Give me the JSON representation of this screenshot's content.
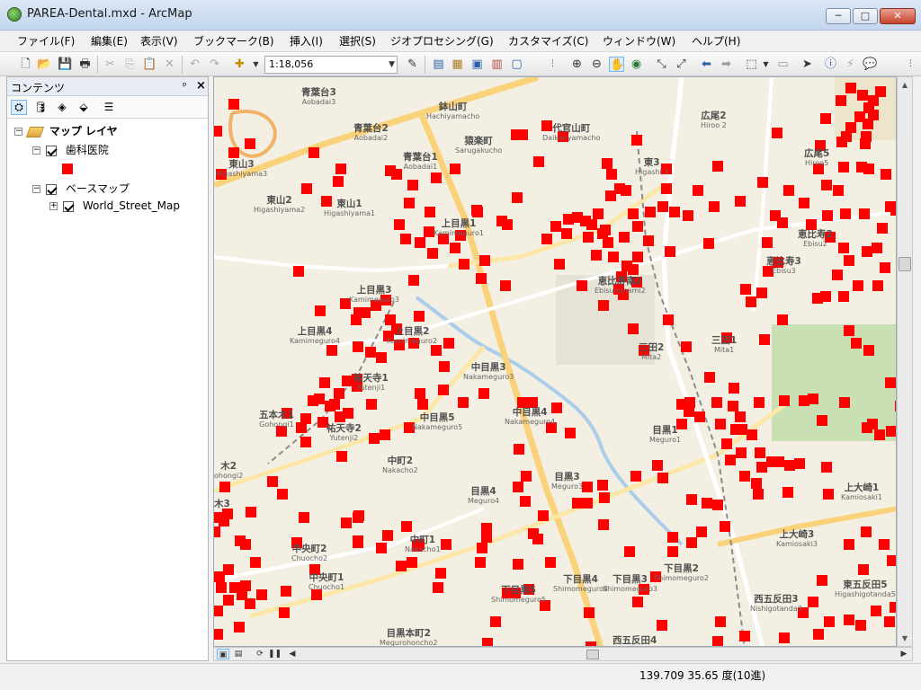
{
  "window": {
    "title": "PAREA-Dental.mxd - ArcMap",
    "minimize_glyph": "─",
    "maximize_glyph": "□",
    "close_glyph": "✕"
  },
  "menu": [
    {
      "label": "ファイル(F)"
    },
    {
      "label": "編集(E)"
    },
    {
      "label": "表示(V)"
    },
    {
      "label": "ブックマーク(B)"
    },
    {
      "label": "挿入(I)"
    },
    {
      "label": "選択(S)"
    },
    {
      "label": "ジオプロセシング(G)"
    },
    {
      "label": "カスタマイズ(C)"
    },
    {
      "label": "ウィンドウ(W)"
    },
    {
      "label": "ヘルプ(H)"
    }
  ],
  "toolbar": {
    "scale_value": "1:18,056"
  },
  "contents": {
    "header": "コンテンツ",
    "pin_glyph": "ᵖ",
    "close_glyph": "×",
    "root_label": "マップ レイヤ",
    "layer1_label": "歯科医院",
    "layer1_color": "#ff0000",
    "group_label": "ベースマップ",
    "layer2_label": "World_Street_Map"
  },
  "map": {
    "point_color": "#ff0000",
    "places": [
      {
        "jp": "青葉台3",
        "en": "Aobadai3"
      },
      {
        "jp": "鉢山町",
        "en": "Hachiyamacho"
      },
      {
        "jp": "鶯谷町",
        "en": "Uguisudanicho"
      },
      {
        "jp": "代官山町",
        "en": "Daikanyamacho"
      },
      {
        "jp": "広尾2",
        "en": "Hiroo 2"
      },
      {
        "jp": "青葉台2",
        "en": "Aobadai2"
      },
      {
        "jp": "猿楽町",
        "en": "Sarugakucho"
      },
      {
        "jp": "青葉台1",
        "en": "Aobadai1"
      },
      {
        "jp": "東3",
        "en": "Higashi 3"
      },
      {
        "jp": "広尾5",
        "en": "Hiroo5"
      },
      {
        "jp": "東山3",
        "en": "Higashiyama3"
      },
      {
        "jp": "東山2",
        "en": "Higashiyama2"
      },
      {
        "jp": "東山1",
        "en": "Higashiyama1"
      },
      {
        "jp": "上目黒1",
        "en": "Kamimeguro1"
      },
      {
        "jp": "恵比寿2",
        "en": "Ebisu2"
      },
      {
        "jp": "恵比寿3",
        "en": "Ebisu3"
      },
      {
        "jp": "上目黒3",
        "en": "Kamimeguro3"
      },
      {
        "jp": "恵比寿南2",
        "en": "Ebisuminami2"
      },
      {
        "jp": "上目黒4",
        "en": "Kamimeguro4"
      },
      {
        "jp": "上目黒2",
        "en": "Kamimeguro2"
      },
      {
        "jp": "三田2",
        "en": "Mita2"
      },
      {
        "jp": "三田1",
        "en": "Mita1"
      },
      {
        "jp": "祐天寺1",
        "en": "Yutenji1"
      },
      {
        "jp": "中目黒3",
        "en": "Nakameguro3"
      },
      {
        "jp": "五本木1",
        "en": "Gohongi1"
      },
      {
        "jp": "祐天寺2",
        "en": "Yutenji2"
      },
      {
        "jp": "中目黒5",
        "en": "Nakameguro5"
      },
      {
        "jp": "中目黒4",
        "en": "Nakameguro4"
      },
      {
        "jp": "目黒1",
        "en": "Meguro1"
      },
      {
        "jp": "五本木2",
        "en": "Gohongi2"
      },
      {
        "jp": "中町2",
        "en": "Nakacho2"
      },
      {
        "jp": "目黒3",
        "en": "Meguro3"
      },
      {
        "jp": "目黒4",
        "en": "Meguro4"
      },
      {
        "jp": "上大崎1",
        "en": "Kamiosaki1"
      },
      {
        "jp": "中町1",
        "en": "Nakacho1"
      },
      {
        "jp": "上大崎3",
        "en": "Kamiosaki3"
      },
      {
        "jp": "中央町2",
        "en": "Chuocho2"
      },
      {
        "jp": "下目黒2",
        "en": "Shimomeguro2"
      },
      {
        "jp": "中央町1",
        "en": "Chuocho1"
      },
      {
        "jp": "下目黒5",
        "en": "Shimomeguro5"
      },
      {
        "jp": "下目黒4",
        "en": "Shimomeguro4"
      },
      {
        "jp": "下目黒3",
        "en": "Shimomeguro3"
      },
      {
        "jp": "西五反田3",
        "en": "Nishigotanda3"
      },
      {
        "jp": "東五反田5",
        "en": "Higashigotanda5"
      },
      {
        "jp": "目黒本町2",
        "en": "Megurohoncho2"
      },
      {
        "jp": "西五反田4",
        "en": ""
      },
      {
        "jp": "木2",
        "en": "ohongi2"
      },
      {
        "jp": "木3",
        "en": ""
      }
    ]
  },
  "status": {
    "coordinates": "139.709  35.65 度(10進)"
  }
}
